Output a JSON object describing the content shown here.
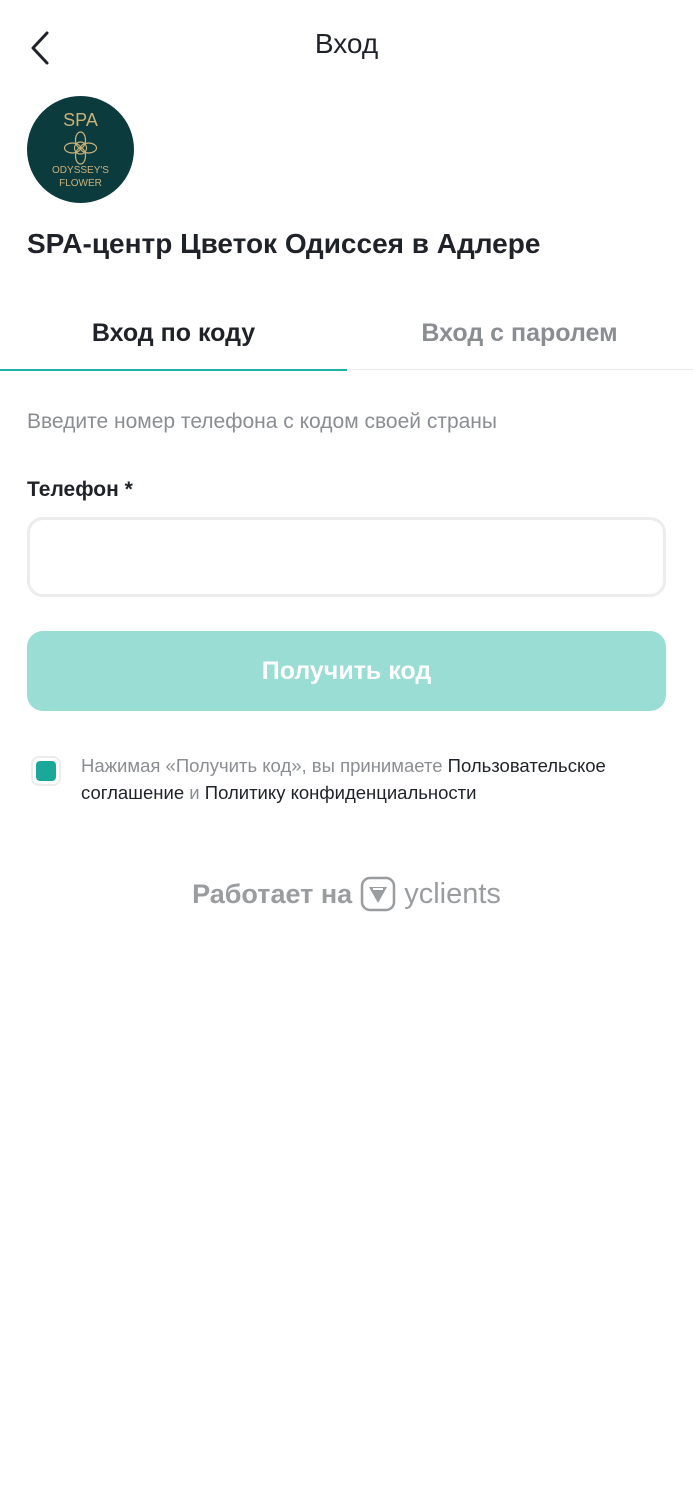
{
  "header": {
    "title": "Вход",
    "back_icon": "chevron-left-icon"
  },
  "logo": {
    "top_text": "SPA",
    "line1": "ODYSSEY'S",
    "line2": "FLOWER",
    "bg_color": "#0c3b3d",
    "accent_color": "#c9b27a"
  },
  "company": {
    "name": "SPA-центр Цветок Одиссея в Адлере"
  },
  "tabs": [
    {
      "label": "Вход по коду",
      "active": true
    },
    {
      "label": "Вход с паролем",
      "active": false
    }
  ],
  "form": {
    "hint": "Введите номер телефона с кодом своей страны",
    "phone_label": "Телефон *",
    "phone_value": "",
    "phone_placeholder": "",
    "submit_label": "Получить код"
  },
  "agreement": {
    "checked": true,
    "text_before": "Нажимая «Получить код», вы принимаете ",
    "link1": "Пользовательское соглашение",
    "text_middle": " и ",
    "link2": "Политику конфиденциальности"
  },
  "footer": {
    "powered_text": "Работает на",
    "brand": "yclients",
    "brand_icon": "yclients-logo-icon"
  },
  "colors": {
    "accent": "#1fb2a5",
    "button_disabled": "#99ddd5",
    "checkbox": "#1aa89b",
    "text_muted": "#8a8d91"
  }
}
